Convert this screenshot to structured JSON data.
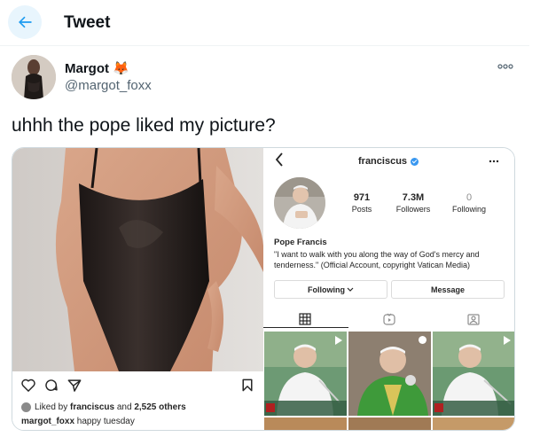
{
  "header": {
    "title": "Tweet",
    "back_icon": "arrow-left-icon"
  },
  "tweet": {
    "author_name": "Margot",
    "author_emoji": "🦊",
    "handle": "@margot_foxx",
    "text": "uhhh the pope liked my picture?"
  },
  "left_post": {
    "liked_by_prefix": "Liked by",
    "liked_by_user": "franciscus",
    "liked_by_and": "and",
    "liked_by_others": "2,525 others",
    "caption_user": "margot_foxx",
    "caption_text": "happy tuesday"
  },
  "profile": {
    "username": "franciscus",
    "stats": [
      {
        "value": "971",
        "label": "Posts"
      },
      {
        "value": "7.3M",
        "label": "Followers"
      },
      {
        "value": "0",
        "label": "Following"
      }
    ],
    "name": "Pope Francis",
    "bio": "\"I want to walk with you along the way of God's mercy and tenderness.\" (Official Account, copyright Vatican Media)",
    "following_button": "Following",
    "message_button": "Message"
  },
  "colors": {
    "accent": "#1d9bf0",
    "verified": "#3897f0"
  }
}
